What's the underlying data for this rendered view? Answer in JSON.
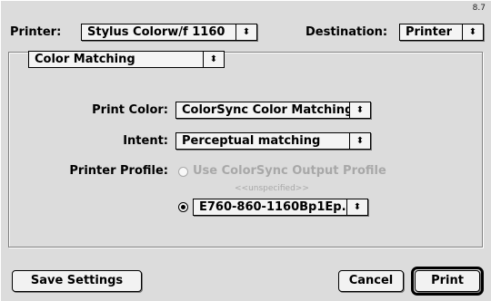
{
  "dialog": {
    "version": "8.7"
  },
  "printer": {
    "label": "Printer:",
    "value": "Stylus Colorw/f 1160"
  },
  "destination": {
    "label": "Destination:",
    "value": "Printer"
  },
  "panel": {
    "value": "Color Matching"
  },
  "print_color": {
    "label": "Print Color:",
    "value": "ColorSync Color Matching"
  },
  "intent": {
    "label": "Intent:",
    "value": "Perceptual matching"
  },
  "printer_profile": {
    "label": "Printer Profile:",
    "option_colorsync": "Use ColorSync Output Profile",
    "option_colorsync_note": "<<unspecified>>",
    "option_colorsync_selected": false,
    "option_colorsync_enabled": false,
    "option_custom_value": "E760-860-1160Bp1Ep...",
    "option_custom_selected": true
  },
  "buttons": {
    "save": "Save Settings",
    "cancel": "Cancel",
    "print": "Print"
  },
  "icons": {
    "popup_arrows": "⬍"
  }
}
